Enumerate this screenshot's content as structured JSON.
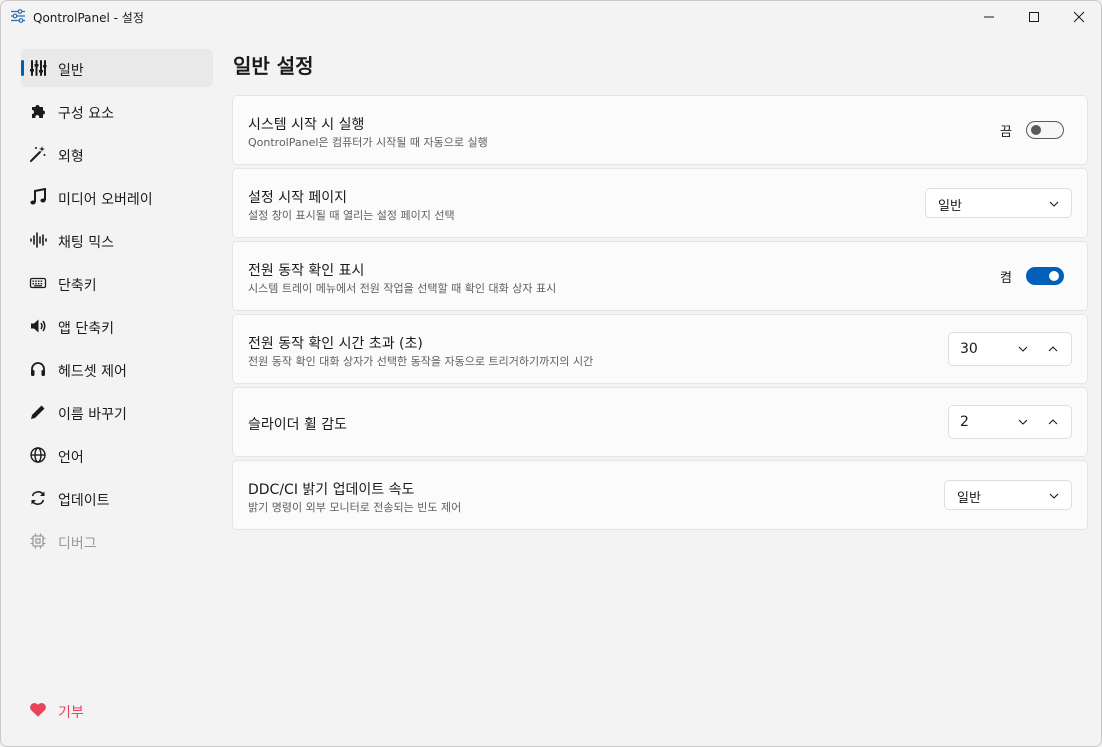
{
  "window": {
    "title": "QontrolPanel - 설정",
    "accent": "#005fb8"
  },
  "sidebar": {
    "items": [
      {
        "label": "일반",
        "icon": "sliders-icon",
        "selected": true
      },
      {
        "label": "구성 요소",
        "icon": "puzzle-icon"
      },
      {
        "label": "외형",
        "icon": "magic-wand-icon"
      },
      {
        "label": "미디어 오버레이",
        "icon": "music-note-icon"
      },
      {
        "label": "채팅 믹스",
        "icon": "waveform-icon"
      },
      {
        "label": "단축키",
        "icon": "keyboard-icon"
      },
      {
        "label": "앱 단축키",
        "icon": "speaker-icon"
      },
      {
        "label": "헤드셋 제어",
        "icon": "headset-icon"
      },
      {
        "label": "이름 바꾸기",
        "icon": "pencil-icon"
      },
      {
        "label": "언어",
        "icon": "globe-icon"
      },
      {
        "label": "업데이트",
        "icon": "refresh-icon"
      },
      {
        "label": "디버그",
        "icon": "chip-icon",
        "disabled": true
      }
    ],
    "donate": {
      "label": "기부",
      "icon": "heart-icon",
      "color": "#e8455a"
    }
  },
  "main": {
    "title": "일반 설정",
    "settings": [
      {
        "title": "시스템 시작 시 실행",
        "description": "QontrolPanel은 컴퓨터가 시작될 때 자동으로 실행",
        "control": "toggle",
        "state_label": "끔",
        "on": false
      },
      {
        "title": "설정 시작 페이지",
        "description": "설정 창이 표시될 때 열리는 설정 페이지 선택",
        "control": "dropdown",
        "value": "일반"
      },
      {
        "title": "전원 동작 확인 표시",
        "description": "시스템 트레이 메뉴에서 전원 작업을 선택할 때 확인 대화 상자 표시",
        "control": "toggle",
        "state_label": "켬",
        "on": true
      },
      {
        "title": "전원 동작 확인 시간 초과 (초)",
        "description": "전원 동작 확인 대화 상자가 선택한 동작을 자동으로 트리거하기까지의 시간",
        "control": "spinbox",
        "value": "30"
      },
      {
        "title": "슬라이더 휠 감도",
        "control": "spinbox",
        "value": "2"
      },
      {
        "title": "DDC/CI 밝기 업데이트 속도",
        "description": "밝기 명령이 외부 모니터로 전송되는 빈도 제어",
        "control": "dropdown",
        "value": "일반"
      }
    ]
  }
}
